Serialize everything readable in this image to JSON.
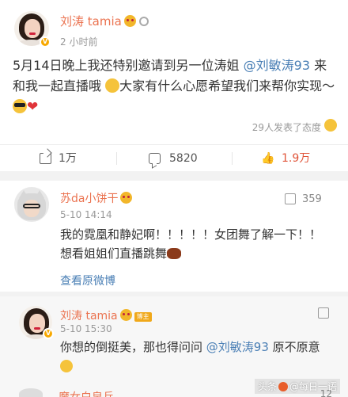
{
  "post": {
    "author": "刘涛 tamia",
    "time": "2 小时前",
    "text_p1": "5月14日晚上我还特别邀请到另一位涛姐 ",
    "mention": "@刘敏涛93",
    "text_p2": " 来和我一起直播哦 ",
    "text_p3": "大家有什么心愿希望我们来帮你实现～",
    "likers_text": "29人发表了态度",
    "actions": {
      "share_count": "1万",
      "comment_count": "5820",
      "like_count": "1.9万"
    }
  },
  "comment1": {
    "author": "苏da小饼干",
    "time": "5-10 14:14",
    "likes": "359",
    "text": "我的霓凰和静妃啊！！！！！女团舞了解一下！！想看姐姐们直播跳舞",
    "view_original": "查看原微博"
  },
  "reply": {
    "author": "刘涛 tamia",
    "badge": "博主",
    "time": "5-10 15:30",
    "text_p1": "你想的倒挺美，那也得问问 ",
    "mention": "@刘敏涛93",
    "text_p2": " 原不原意",
    "likes": "12",
    "next_author": "魔女白泉兵"
  },
  "watermark": {
    "prefix": "头条",
    "handle": "@每日一语"
  },
  "colors": {
    "name": "#eb7350",
    "mention": "#4a7fb5",
    "vip": "#f7a800"
  }
}
